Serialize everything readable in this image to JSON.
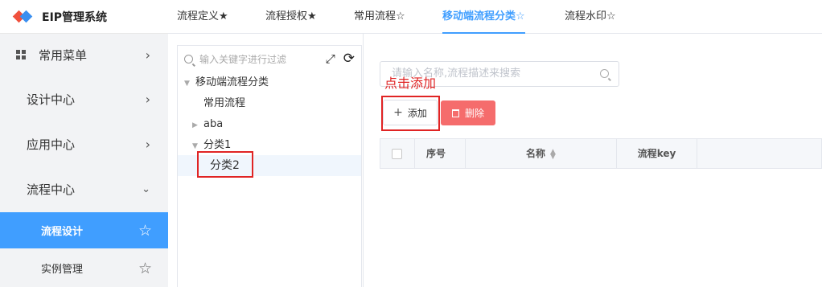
{
  "app": {
    "title": "EIP管理系统"
  },
  "sidebar": {
    "items": [
      {
        "label": "常用菜单"
      },
      {
        "label": "设计中心"
      },
      {
        "label": "应用中心"
      },
      {
        "label": "流程中心"
      }
    ],
    "sub_items": [
      {
        "label": "流程设计",
        "active": true
      },
      {
        "label": "实例管理",
        "active": false
      }
    ]
  },
  "tabs": [
    {
      "label": "流程定义★"
    },
    {
      "label": "流程授权★"
    },
    {
      "label": "常用流程☆"
    },
    {
      "label": "移动端流程分类☆",
      "active": true
    },
    {
      "label": "流程水印☆"
    }
  ],
  "tree": {
    "search_placeholder": "输入关键字进行过滤",
    "nodes": [
      {
        "label": "移动端流程分类"
      },
      {
        "label": "常用流程"
      },
      {
        "label": "aba"
      },
      {
        "label": "分类1"
      },
      {
        "label": "分类2",
        "selected": true
      }
    ]
  },
  "main": {
    "search_placeholder": "请输入名称,流程描述来搜索",
    "hint": "点击添加",
    "add_label": "添加",
    "delete_label": "删除",
    "columns": [
      "序号",
      "名称",
      "流程key"
    ]
  },
  "colors": {
    "accent": "#409eff",
    "danger": "#f56c6c",
    "annotation": "#e02424"
  }
}
